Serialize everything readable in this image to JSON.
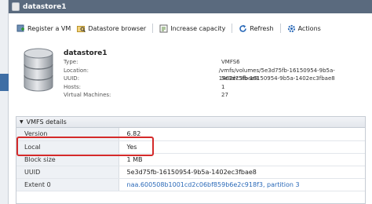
{
  "window": {
    "title": "datastore1"
  },
  "toolbar": {
    "register_vm": "Register a VM",
    "datastore_browser": "Datastore browser",
    "increase_capacity": "Increase capacity",
    "refresh": "Refresh",
    "actions": "Actions"
  },
  "summary": {
    "name": "datastore1",
    "rows": [
      {
        "label": "Type:",
        "value": "VMFS6"
      },
      {
        "label": "Location:",
        "value": "/vmfs/volumes/5e3d75fb-16150954-9b5a-1402ec3fbae8"
      },
      {
        "label": "UUID:",
        "value": "5e3d75fb-16150954-9b5a-1402ec3fbae8"
      },
      {
        "label": "Hosts:",
        "value": "1"
      },
      {
        "label": "Virtual Machines:",
        "value": "27"
      }
    ]
  },
  "details": {
    "title": "VMFS details",
    "rows": [
      {
        "label": "Version",
        "value": "6.82"
      },
      {
        "label": "Local",
        "value": "Yes"
      },
      {
        "label": "Block size",
        "value": "1 MB"
      },
      {
        "label": "UUID",
        "value": "5e3d75fb-16150954-9b5a-1402ec3fbae8"
      },
      {
        "label": "Extent 0",
        "value": "naa.600508b1001cd2c06bf859b6e2c918f3, partition 3"
      }
    ]
  },
  "colors": {
    "titlebar": "#5a6a7e",
    "link": "#2a69b8",
    "highlight": "#d42a2a"
  }
}
